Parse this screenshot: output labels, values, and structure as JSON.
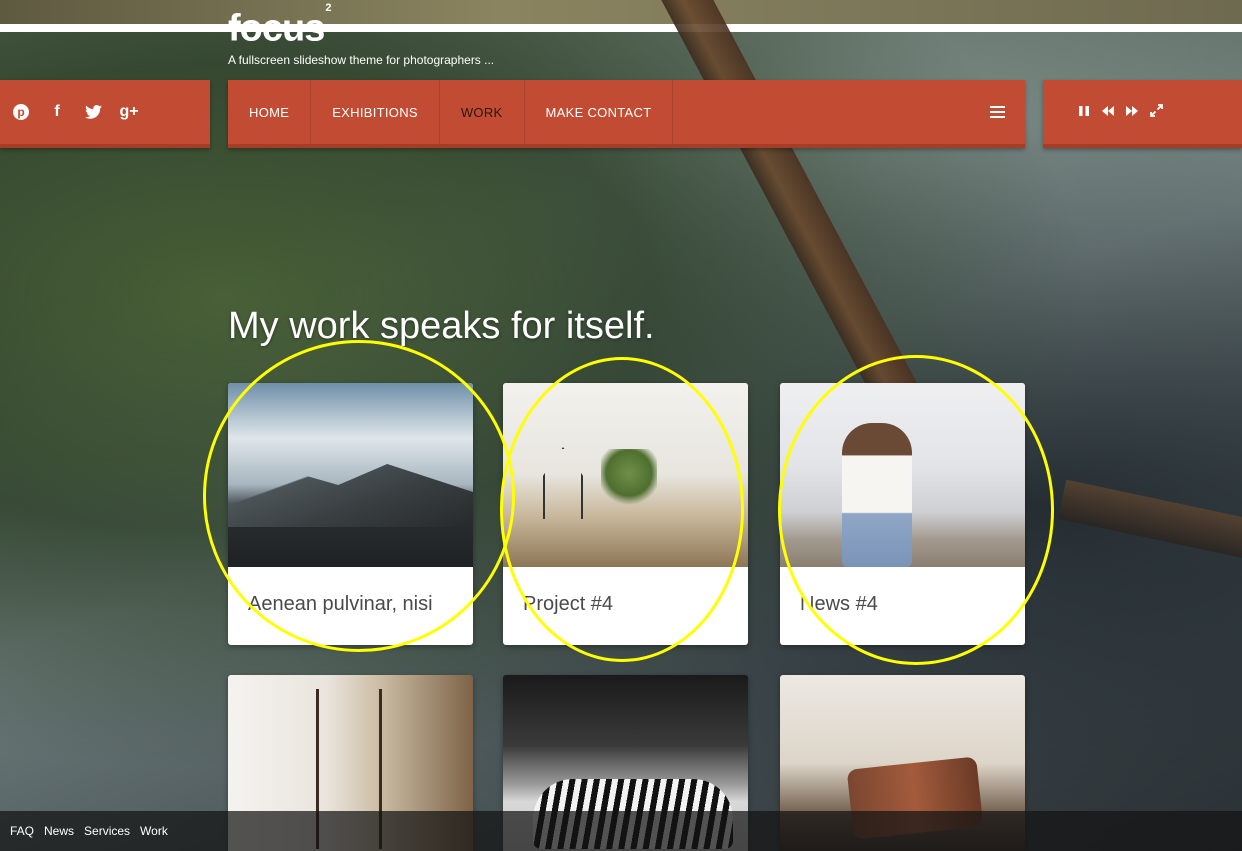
{
  "site": {
    "logo": "focus",
    "logo_sup": "2",
    "tagline": "A fullscreen slideshow theme for photographers  ..."
  },
  "social": [
    {
      "icon": "pinterest-icon",
      "glyph": "p"
    },
    {
      "icon": "facebook-icon",
      "glyph": "f"
    },
    {
      "icon": "twitter-icon",
      "glyph": "🐦"
    },
    {
      "icon": "google-plus-icon",
      "glyph": "g+"
    }
  ],
  "nav": {
    "items": [
      {
        "label": "HOME"
      },
      {
        "label": "EXHIBITIONS"
      },
      {
        "label": "WORK"
      },
      {
        "label": "MAKE CONTACT"
      }
    ],
    "active": "WORK"
  },
  "controls": [
    {
      "icon": "pause-icon",
      "glyph": "❚❚"
    },
    {
      "icon": "rewind-icon",
      "glyph": "◀◀"
    },
    {
      "icon": "fast-forward-icon",
      "glyph": "▶▶"
    },
    {
      "icon": "fullscreen-icon",
      "glyph": "⤢"
    }
  ],
  "main": {
    "heading": "My work speaks for itself.",
    "cards": [
      {
        "title": "Aenean pulvinar, nisi"
      },
      {
        "title": "Project #4"
      },
      {
        "title": "News #4"
      }
    ]
  },
  "footer": {
    "links": [
      "FAQ",
      "News",
      "Services",
      "Work"
    ]
  },
  "colors": {
    "accent": "#c24c33",
    "annotation": "#ffff00"
  }
}
